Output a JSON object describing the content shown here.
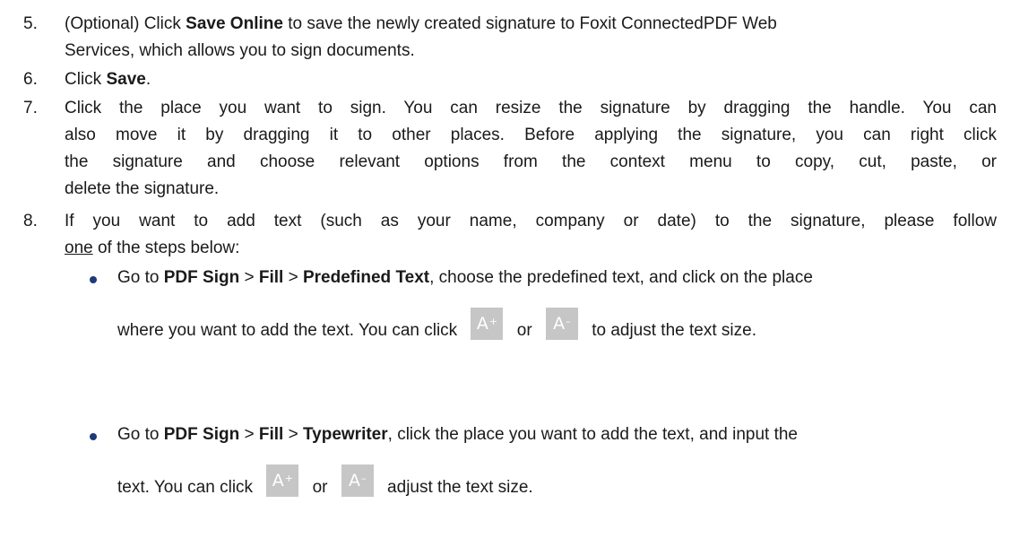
{
  "steps": [
    {
      "number": "5.",
      "lines": [
        [
          "(Optional) Click ",
          "Save Online",
          " to save the newly created signature to Foxit ConnectedPDF Web"
        ],
        [
          "Services, which allows you to sign documents."
        ]
      ]
    },
    {
      "number": "6.",
      "lines": [
        [
          "Click ",
          "Save",
          "."
        ]
      ]
    },
    {
      "number": "7.",
      "lines": [
        "Click the place you want to sign. You can resize the signature by dragging the handle. You can",
        "also move it by dragging it to other places. Before applying the signature, you can right click",
        "the signature and choose relevant options from the context menu to copy, cut, paste, or",
        "delete the signature."
      ]
    },
    {
      "number": "8.",
      "line1": "If you want to add text (such as your name, company or date) to the signature, please follow",
      "line2_underlined": "one",
      "line2_rest": " of the steps below:"
    }
  ],
  "bullets": [
    {
      "go_to": "Go to ",
      "menu1": "PDF Sign",
      "sep1": " > ",
      "menu2": "Fill",
      "sep2": " > ",
      "menu3": "Predefined Text",
      "after": ", choose the predefined text, and click on the place",
      "line2_pre": "where you want to add the text. You can click ",
      "or": " or ",
      "line2_post": " to adjust the text size."
    },
    {
      "go_to": "Go to ",
      "menu1": "PDF Sign",
      "sep1": " > ",
      "menu2": "Fill",
      "sep2": " > ",
      "menu3": "Typewriter",
      "after": ", click the place you want to add the text, and input the",
      "line2_pre": "text. You can click ",
      "or": " or ",
      "line2_post": " adjust the text size."
    }
  ],
  "icons": {
    "increase": {
      "letter": "A",
      "mark": "+",
      "name": "font-increase-icon",
      "bg": "#c6c6c6"
    },
    "decrease": {
      "letter": "A",
      "mark": "–",
      "name": "font-decrease-icon",
      "bg": "#c6c6c6"
    }
  },
  "colors": {
    "text": "#1a1a1a",
    "bullet": "#1f3a7a",
    "icon_bg": "#c6c6c6"
  }
}
